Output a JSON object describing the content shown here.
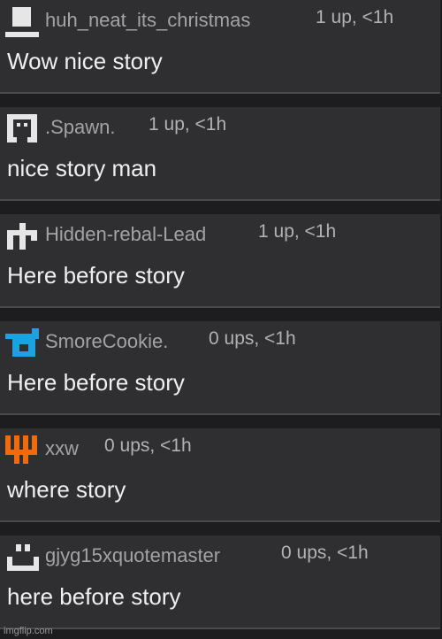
{
  "comments": [
    {
      "username": "huh_neat_its_christmas",
      "meta": "1 up, <1h",
      "text": "Wow nice story",
      "avatar_icon": "white-hat-avatar-icon",
      "avatar_color": "#e6e6e6"
    },
    {
      "username": ".Spawn.",
      "meta": "1 up, <1h",
      "text": "nice story man",
      "avatar_icon": "white-bracket-face-avatar-icon",
      "avatar_color": "#e6e6e6"
    },
    {
      "username": "Hidden-rebal-Lead",
      "meta": "1 up, <1h",
      "text": "Here before story",
      "avatar_icon": "white-pillars-avatar-icon",
      "avatar_color": "#e6e6e6"
    },
    {
      "username": "SmoreCookie.",
      "meta": "0 ups, <1h",
      "text": "Here before story",
      "avatar_icon": "blue-block-avatar-icon",
      "avatar_color": "#1aa3e0"
    },
    {
      "username": "xxw",
      "meta": "0 ups, <1h",
      "text": "where story",
      "avatar_icon": "orange-stripes-avatar-icon",
      "avatar_color": "#f26a0e"
    },
    {
      "username": "gjyg15xquotemaster",
      "meta": "0 ups, <1h",
      "text": "here before story",
      "avatar_icon": "white-smile-avatar-icon",
      "avatar_color": "#e6e6e6"
    }
  ],
  "watermark": "imgflip.com"
}
